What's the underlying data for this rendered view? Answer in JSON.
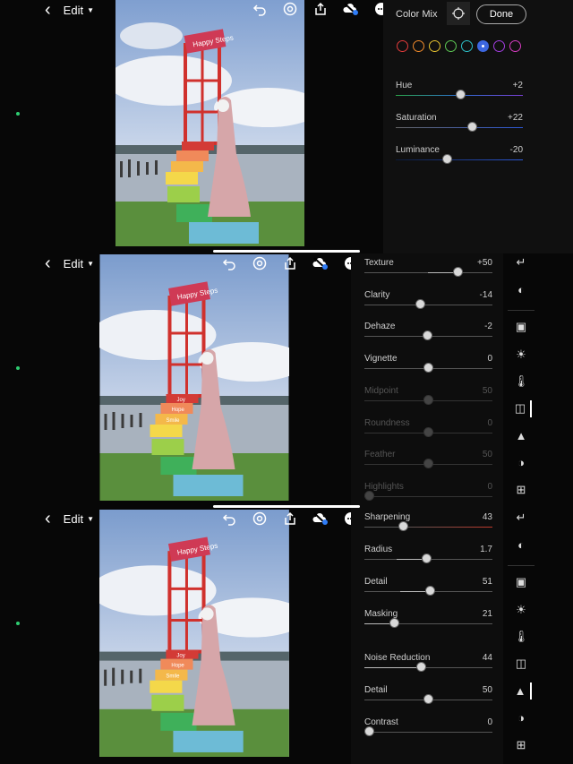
{
  "panel1": {
    "edit_label": "Edit",
    "color_mix_label": "Color Mix",
    "done_label": "Done",
    "swatch_colors": [
      "#e23b3b",
      "#f08a2b",
      "#e6c22f",
      "#5cc653",
      "#2cc0c8",
      "#3c67e0",
      "#a13de0",
      "#d63cc0"
    ],
    "sliders": [
      {
        "label": "Hue",
        "value": "+2"
      },
      {
        "label": "Saturation",
        "value": "+22"
      },
      {
        "label": "Luminance",
        "value": "-20"
      }
    ]
  },
  "panel2": {
    "edit_label": "Edit",
    "sliders": [
      {
        "label": "Texture",
        "value": "+50"
      },
      {
        "label": "Clarity",
        "value": "-14"
      },
      {
        "label": "Dehaze",
        "value": "-2"
      },
      {
        "label": "Vignette",
        "value": "0"
      },
      {
        "label": "Midpoint",
        "value": "50"
      },
      {
        "label": "Roundness",
        "value": "0"
      },
      {
        "label": "Feather",
        "value": "50"
      },
      {
        "label": "Highlights",
        "value": "0"
      }
    ]
  },
  "panel3": {
    "edit_label": "Edit",
    "sliders": [
      {
        "label": "Sharpening",
        "value": "43"
      },
      {
        "label": "Radius",
        "value": "1.7"
      },
      {
        "label": "Detail",
        "value": "51"
      },
      {
        "label": "Masking",
        "value": "21"
      },
      {
        "label": "Noise Reduction",
        "value": "44"
      },
      {
        "label": "Detail",
        "value": "50"
      },
      {
        "label": "Contrast",
        "value": "0"
      }
    ]
  },
  "photo": {
    "sign_text": "Happy Steps",
    "step_labels": [
      "Joy",
      "Hope",
      "Smile"
    ]
  }
}
